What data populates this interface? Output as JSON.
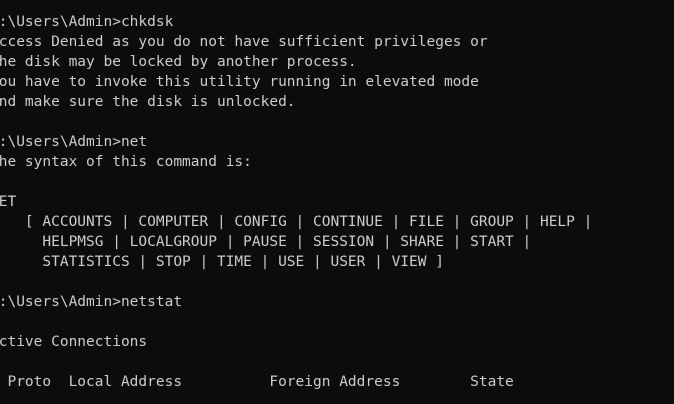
{
  "terminal": {
    "background": "#0c0c0c",
    "foreground": "#cccccc",
    "lines": [
      "C:\\Users\\Admin>chkdsk",
      "Access Denied as you do not have sufficient privileges or",
      "the disk may be locked by another process.",
      "You have to invoke this utility running in elevated mode",
      "and make sure the disk is unlocked.",
      "",
      "C:\\Users\\Admin>net",
      "The syntax of this command is:",
      "",
      "NET",
      "    [ ACCOUNTS | COMPUTER | CONFIG | CONTINUE | FILE | GROUP | HELP |",
      "      HELPMSG | LOCALGROUP | PAUSE | SESSION | SHARE | START |",
      "      STATISTICS | STOP | TIME | USE | USER | VIEW ]",
      "",
      "C:\\Users\\Admin>netstat",
      "",
      "Active Connections",
      "",
      "  Proto  Local Address          Foreign Address        State"
    ]
  }
}
